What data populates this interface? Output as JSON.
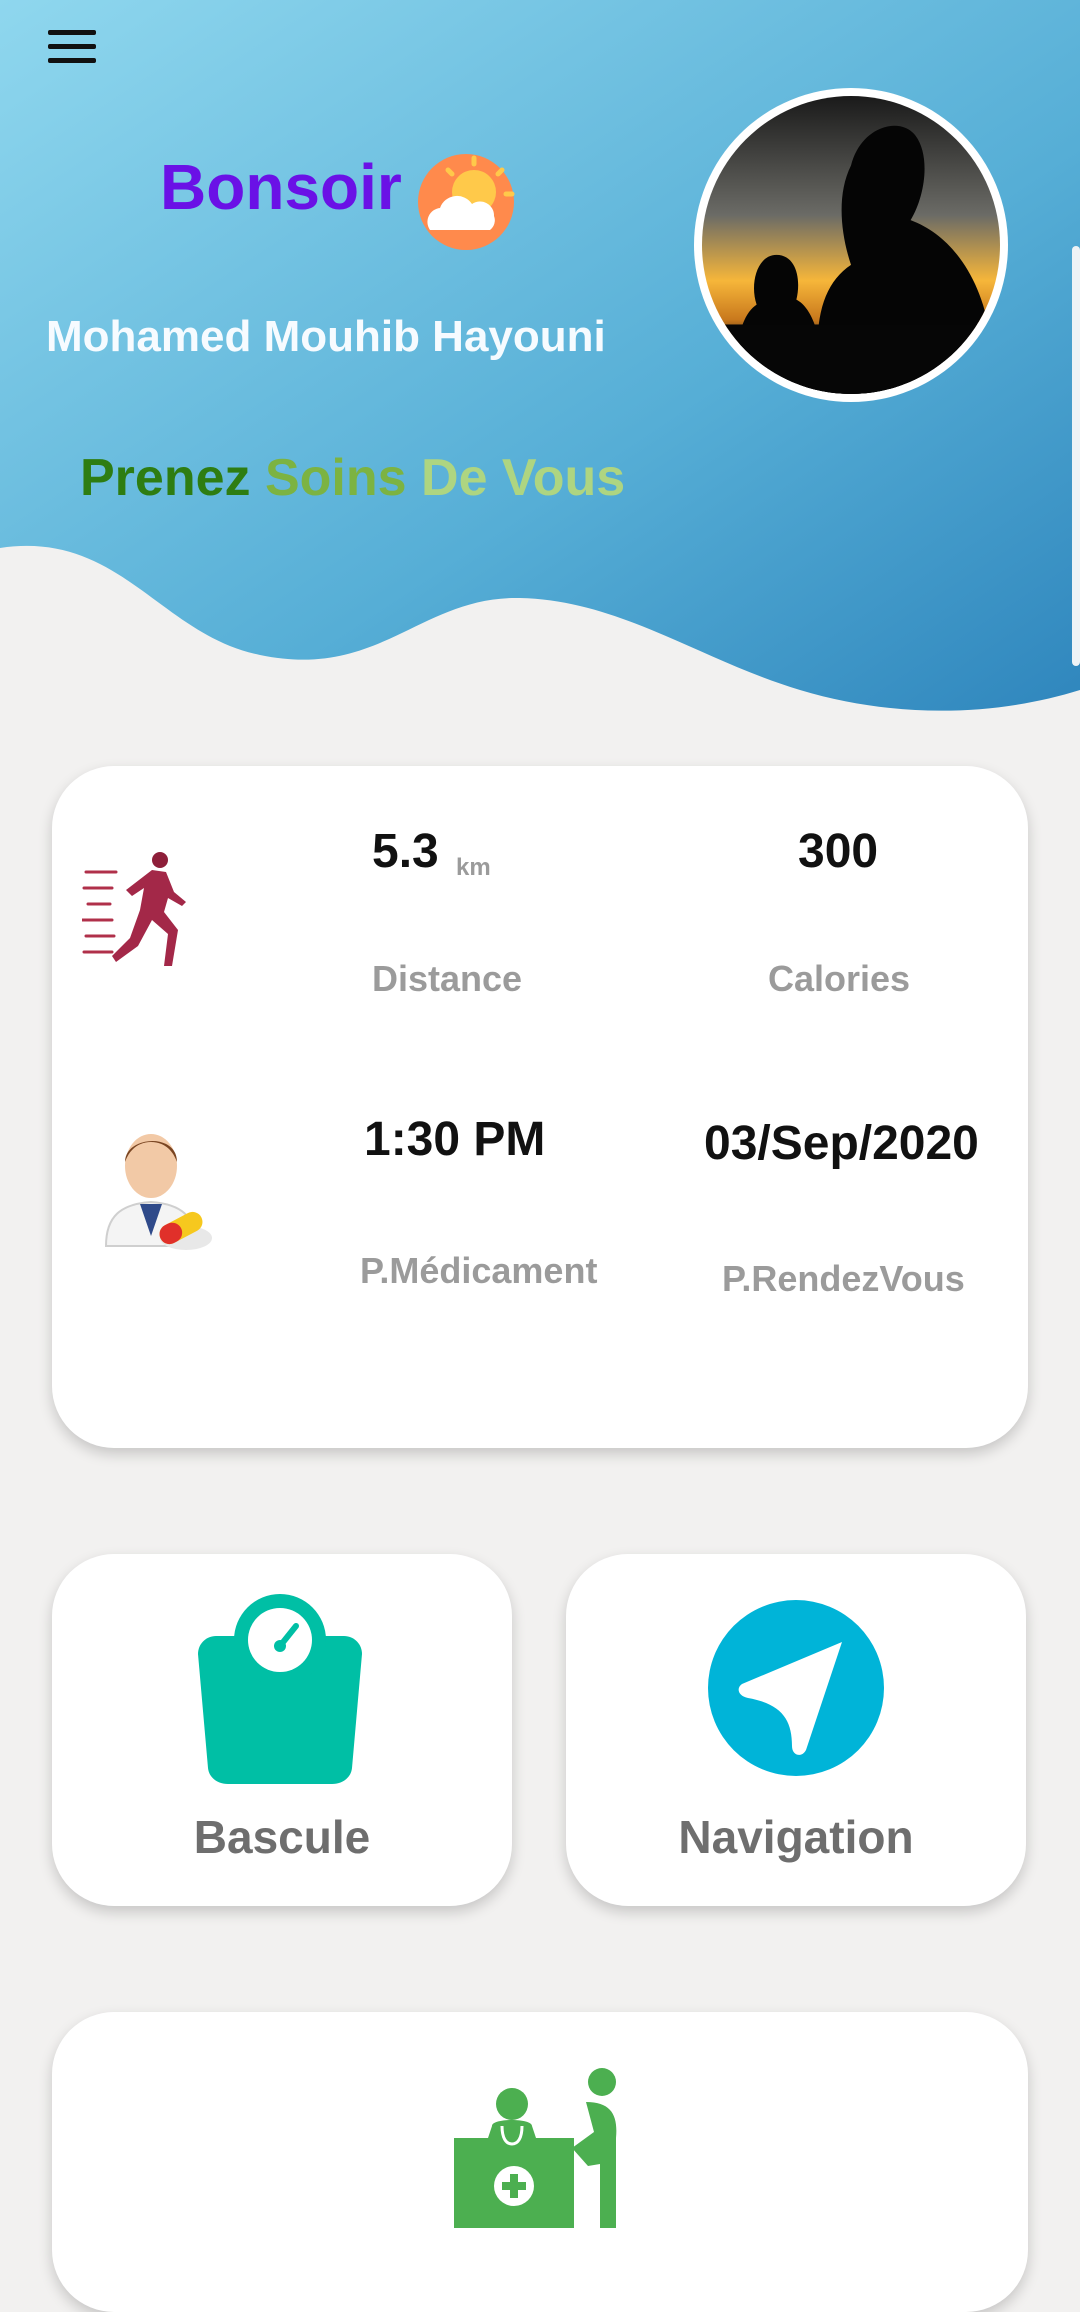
{
  "header": {
    "menu_icon": "hamburger-menu-icon",
    "greeting": "Bonsoir",
    "weather_icon": "partly-cloudy-sun-icon",
    "user_name": "Mohamed Mouhib Hayouni",
    "tagline": {
      "word1": "Prenez",
      "word2": "Soins",
      "word3": "De Vous"
    },
    "colors": {
      "greeting": "#6a11e6",
      "tagline1": "#2e7d12",
      "tagline2": "#7cb342",
      "tagline3": "#aed581",
      "sky_top": "#86d3ec",
      "sky_bottom": "#3a93c4"
    }
  },
  "stats": {
    "distance": {
      "value": "5.3",
      "unit": "km",
      "label": "Distance",
      "icon": "runner-icon"
    },
    "calories": {
      "value": "300",
      "label": "Calories"
    },
    "medication": {
      "value": "1:30 PM",
      "label": "P.Médicament",
      "icon": "doctor-pill-icon"
    },
    "appointment": {
      "value": "03/Sep/2020",
      "label": "P.RendezVous"
    }
  },
  "tiles": [
    {
      "label": "Bascule",
      "icon": "weighing-scale-icon",
      "color": "#00bfa5"
    },
    {
      "label": "Navigation",
      "icon": "navigation-arrow-icon",
      "color": "#00b4d8"
    }
  ],
  "bottom_card": {
    "icon": "pharmacy-consultation-icon",
    "color": "#4caf50"
  }
}
